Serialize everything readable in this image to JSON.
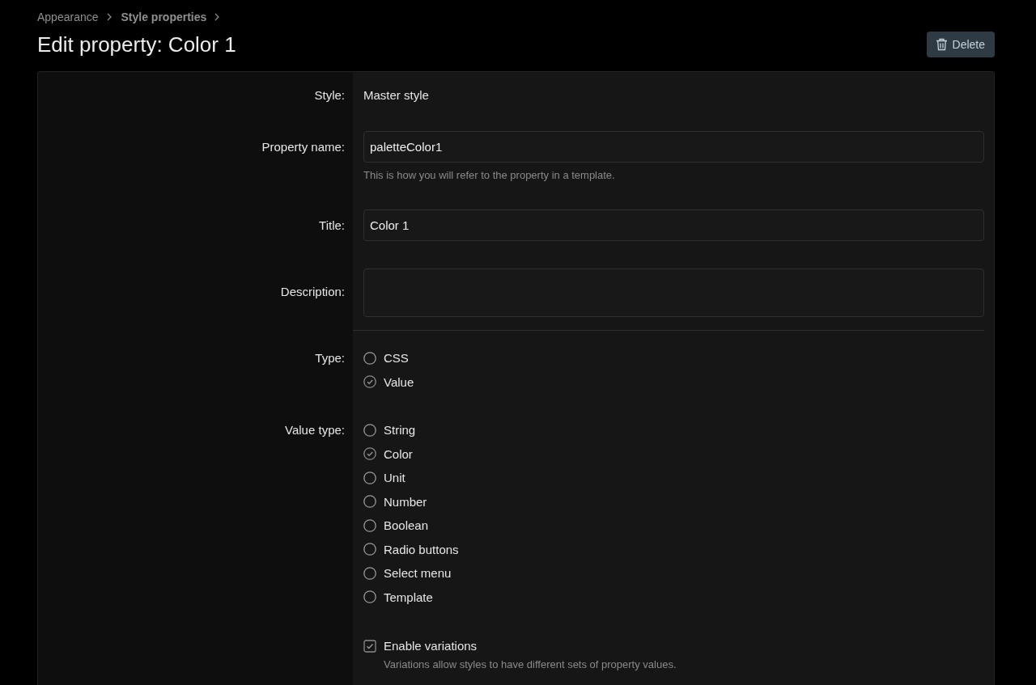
{
  "breadcrumb": [
    {
      "label": "Appearance"
    },
    {
      "label": "Style properties"
    }
  ],
  "title": "Edit property: Color 1",
  "delete_button": {
    "label": "Delete"
  },
  "form": {
    "rows": [
      {
        "kind": "static",
        "label": "Style:",
        "value": "Master style"
      },
      {
        "kind": "input",
        "label": "Property name:",
        "value": "paletteColor1",
        "hint": "This is how you will refer to the property in a template."
      },
      {
        "kind": "input",
        "label": "Title:",
        "value": "Color 1"
      },
      {
        "kind": "textarea",
        "label": "Description:"
      },
      {
        "kind": "radio",
        "label": "Type:",
        "divider_before": true,
        "options": [
          {
            "label": "CSS",
            "selected": false
          },
          {
            "label": "Value",
            "selected": true
          }
        ]
      },
      {
        "kind": "radio",
        "label": "Value type:",
        "options": [
          {
            "label": "String",
            "selected": false
          },
          {
            "label": "Color",
            "selected": true
          },
          {
            "label": "Unit",
            "selected": false
          },
          {
            "label": "Number",
            "selected": false
          },
          {
            "label": "Boolean",
            "selected": false
          },
          {
            "label": "Radio buttons",
            "selected": false
          },
          {
            "label": "Select menu",
            "selected": false
          },
          {
            "label": "Template",
            "selected": false
          }
        ]
      },
      {
        "kind": "checkbox",
        "label": "Enable variations",
        "checked": true,
        "hint": "Variations allow styles to have different sets of property values."
      }
    ]
  }
}
